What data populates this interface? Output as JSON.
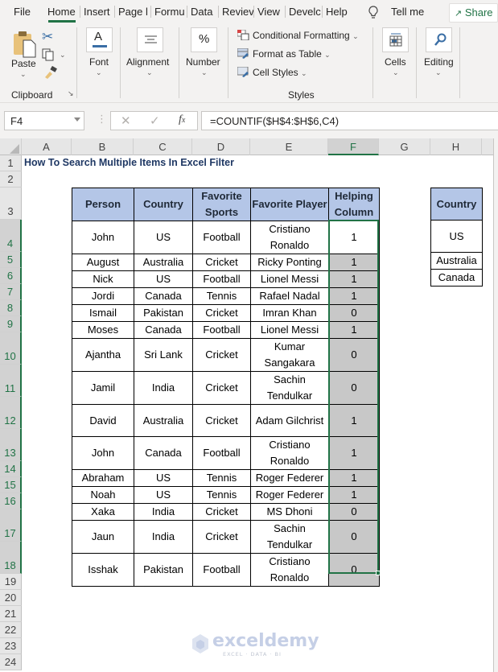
{
  "ribbon_tabs": [
    {
      "label": "File"
    },
    {
      "label": "Home",
      "active": true
    },
    {
      "label": "Insert"
    },
    {
      "label": "Page l"
    },
    {
      "label": "Formu"
    },
    {
      "label": "Data"
    },
    {
      "label": "Reviev"
    },
    {
      "label": "View"
    },
    {
      "label": "Develc"
    },
    {
      "label": "Help"
    }
  ],
  "tell_me": "Tell me",
  "share_label": "Share",
  "ribbon": {
    "clipboard": {
      "paste": "Paste",
      "group": "Clipboard"
    },
    "font": "Font",
    "alignment": "Alignment",
    "number": "Number",
    "styles": {
      "conditional_formatting": "Conditional Formatting",
      "format_as_table": "Format as Table",
      "cell_styles": "Cell Styles",
      "group": "Styles"
    },
    "cells": "Cells",
    "editing": "Editing"
  },
  "formula_bar": {
    "name_box": "F4",
    "formula": "=COUNTIF($H$4:$H$6,C4)"
  },
  "columns": [
    "A",
    "B",
    "C",
    "D",
    "E",
    "F",
    "G",
    "H"
  ],
  "selected_column": "F",
  "rows": [
    "1",
    "2",
    "3",
    "4",
    "5",
    "6",
    "7",
    "8",
    "9",
    "10",
    "11",
    "12",
    "13",
    "14",
    "15",
    "16",
    "17",
    "18",
    "19",
    "20",
    "21",
    "22",
    "23",
    "24"
  ],
  "sheet": {
    "title": "How To Search Multiple Items In Excel Filter",
    "headers": [
      "Person",
      "Country",
      "Favorite Sports",
      "Favorite Player",
      "Helping Column"
    ],
    "data": [
      [
        "John",
        "US",
        "Football",
        "Cristiano Ronaldo",
        "1"
      ],
      [
        "August",
        "Australia",
        "Cricket",
        "Ricky Ponting",
        "1"
      ],
      [
        "Nick",
        "US",
        "Football",
        "Lionel Messi",
        "1"
      ],
      [
        "Jordi",
        "Canada",
        "Tennis",
        "Rafael Nadal",
        "1"
      ],
      [
        "Ismail",
        "Pakistan",
        "Cricket",
        "Imran Khan",
        "0"
      ],
      [
        "Moses",
        "Canada",
        "Football",
        "Lionel Messi",
        "1"
      ],
      [
        "Ajantha",
        "Sri Lank",
        "Cricket",
        "Kumar Sangakara",
        "0"
      ],
      [
        "Jamil",
        "India",
        "Cricket",
        "Sachin Tendulkar",
        "0"
      ],
      [
        "David",
        "Australia",
        "Cricket",
        "Adam Gilchrist",
        "1"
      ],
      [
        "John",
        "Canada",
        "Football",
        "Cristiano Ronaldo",
        "1"
      ],
      [
        "Abraham",
        "US",
        "Tennis",
        "Roger Federer",
        "1"
      ],
      [
        "Noah",
        "US",
        "Tennis",
        "Roger Federer",
        "1"
      ],
      [
        "Xaka",
        "India",
        "Cricket",
        "MS Dhoni",
        "0"
      ],
      [
        "Jaun",
        "India",
        "Cricket",
        "Sachin Tendulkar",
        "0"
      ],
      [
        "Isshak",
        "Pakistan",
        "Football",
        "Cristiano Ronaldo",
        "0"
      ]
    ],
    "criteria": {
      "header": "Country",
      "values": [
        "US",
        "Australia",
        "Canada"
      ]
    }
  },
  "watermark": {
    "name": "exceldemy",
    "tagline": "EXCEL · DATA · BI"
  },
  "colors": {
    "accent": "#217346",
    "header_fill": "#b4c6e7",
    "helper_fill": "#c8c8c8",
    "title": "#1f3864"
  }
}
